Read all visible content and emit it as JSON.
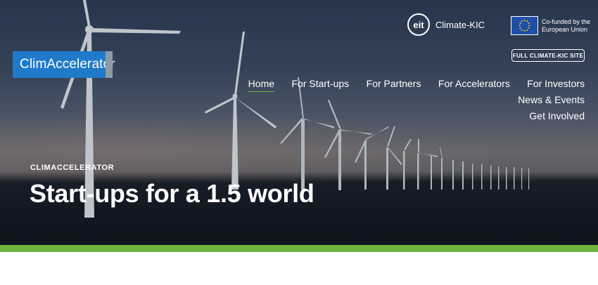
{
  "brand": {
    "name": "ClimAccelerator"
  },
  "partners": {
    "eit_mark": "eit",
    "eit_name": "Climate-KIC",
    "eu_line1": "Co-funded by the",
    "eu_line2": "European Union"
  },
  "header": {
    "full_site_label": "FULL CLIMATE-KIC SITE"
  },
  "nav": {
    "items": [
      {
        "label": "Home"
      },
      {
        "label": "For Start-ups"
      },
      {
        "label": "For Partners"
      },
      {
        "label": "For Accelerators"
      },
      {
        "label": "For Investors"
      },
      {
        "label": "News & Events"
      },
      {
        "label": "Get Involved"
      }
    ]
  },
  "hero": {
    "eyebrow": "CLIMACCELERATOR",
    "title": "Start-ups for a 1.5 world"
  },
  "icons": {
    "eu_flag": "eu-flag-icon",
    "eit_logo": "eit-logo-icon"
  },
  "colors": {
    "brand_blue": "#1f7ac9",
    "accent_green": "#6db33f",
    "eu_blue": "#1f4fa8"
  }
}
